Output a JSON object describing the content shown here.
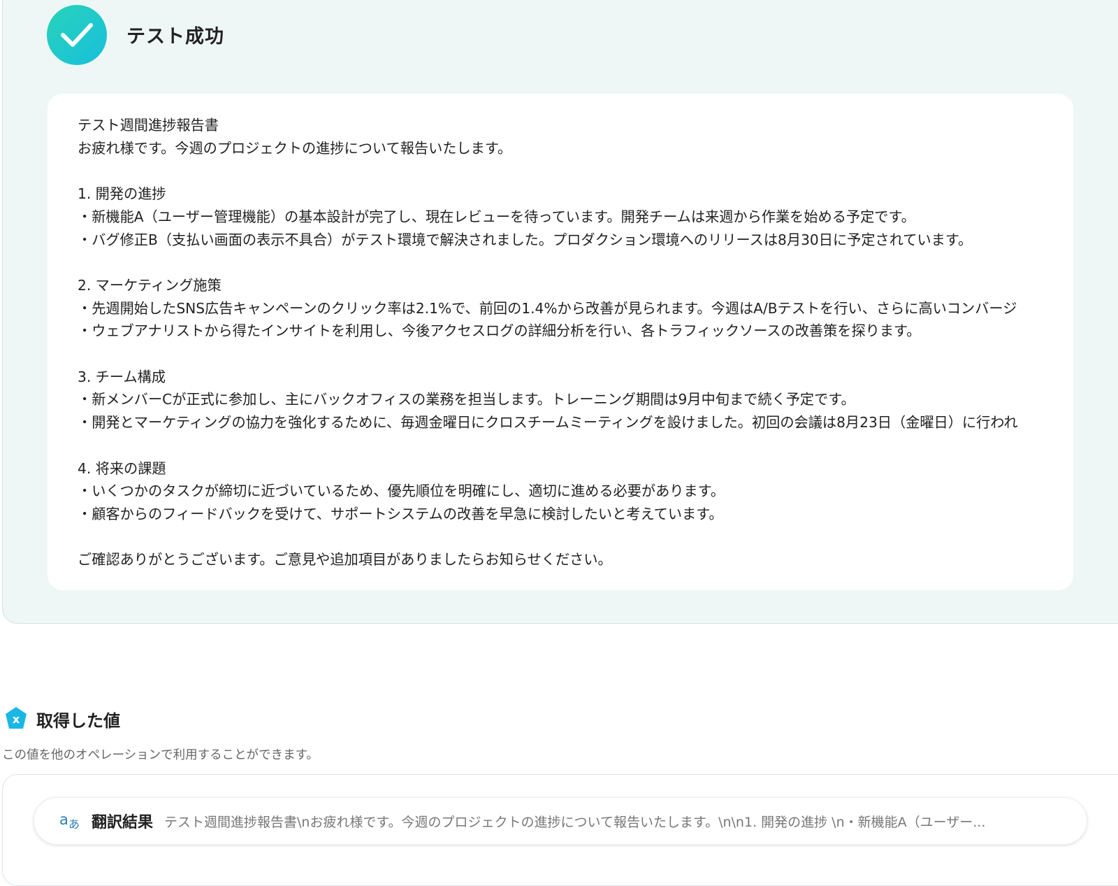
{
  "result": {
    "status_title": "テスト成功",
    "output_text": "テスト週間進捗報告書\nお疲れ様です。今週のプロジェクトの進捗について報告いたします。\n\n1. 開発の進捗\n・新機能A（ユーザー管理機能）の基本設計が完了し、現在レビューを待っています。開発チームは来週から作業を始める予定です。\n・バグ修正B（支払い画面の表示不具合）がテスト環境で解決されました。プロダクション環境へのリリースは8月30日に予定されています。\n\n2. マーケティング施策\n・先週開始したSNS広告キャンペーンのクリック率は2.1%で、前回の1.4%から改善が見られます。今週はA/Bテストを行い、さらに高いコンバージ\n・ウェブアナリストから得たインサイトを利用し、今後アクセスログの詳細分析を行い、各トラフィックソースの改善策を探ります。\n\n3. チーム構成\n・新メンバーCが正式に参加し、主にバックオフィスの業務を担当します。トレーニング期間は9月中旬まで続く予定です。\n・開発とマーケティングの協力を強化するために、毎週金曜日にクロスチームミーティングを設けました。初回の会議は8月23日（金曜日）に行われ\n\n4. 将来の課題\n・いくつかのタスクが締切に近づいているため、優先順位を明確にし、適切に進める必要があります。\n・顧客からのフィードバックを受けて、サポートシステムの改善を早急に検討したいと考えています。\n\nご確認ありがとうございます。ご意見や追加項目がありましたらお知らせください。"
  },
  "acquired_values": {
    "title": "取得した値",
    "description": "この値を他のオペレーションで利用することができます。",
    "items": [
      {
        "label": "翻訳結果",
        "value": "テスト週間進捗報告書\\nお疲れ様です。今週のプロジェクトの進捗について報告いたします。\\n\\n1. 開発の進捗 \\n・新機能A（ユーザー...",
        "icon": "translate-icon"
      }
    ]
  },
  "colors": {
    "success_gradient_start": "#28d3b9",
    "success_gradient_end": "#18bfdc",
    "panel_bg": "#eff7f6",
    "section_icon": "#1ab7e6"
  }
}
